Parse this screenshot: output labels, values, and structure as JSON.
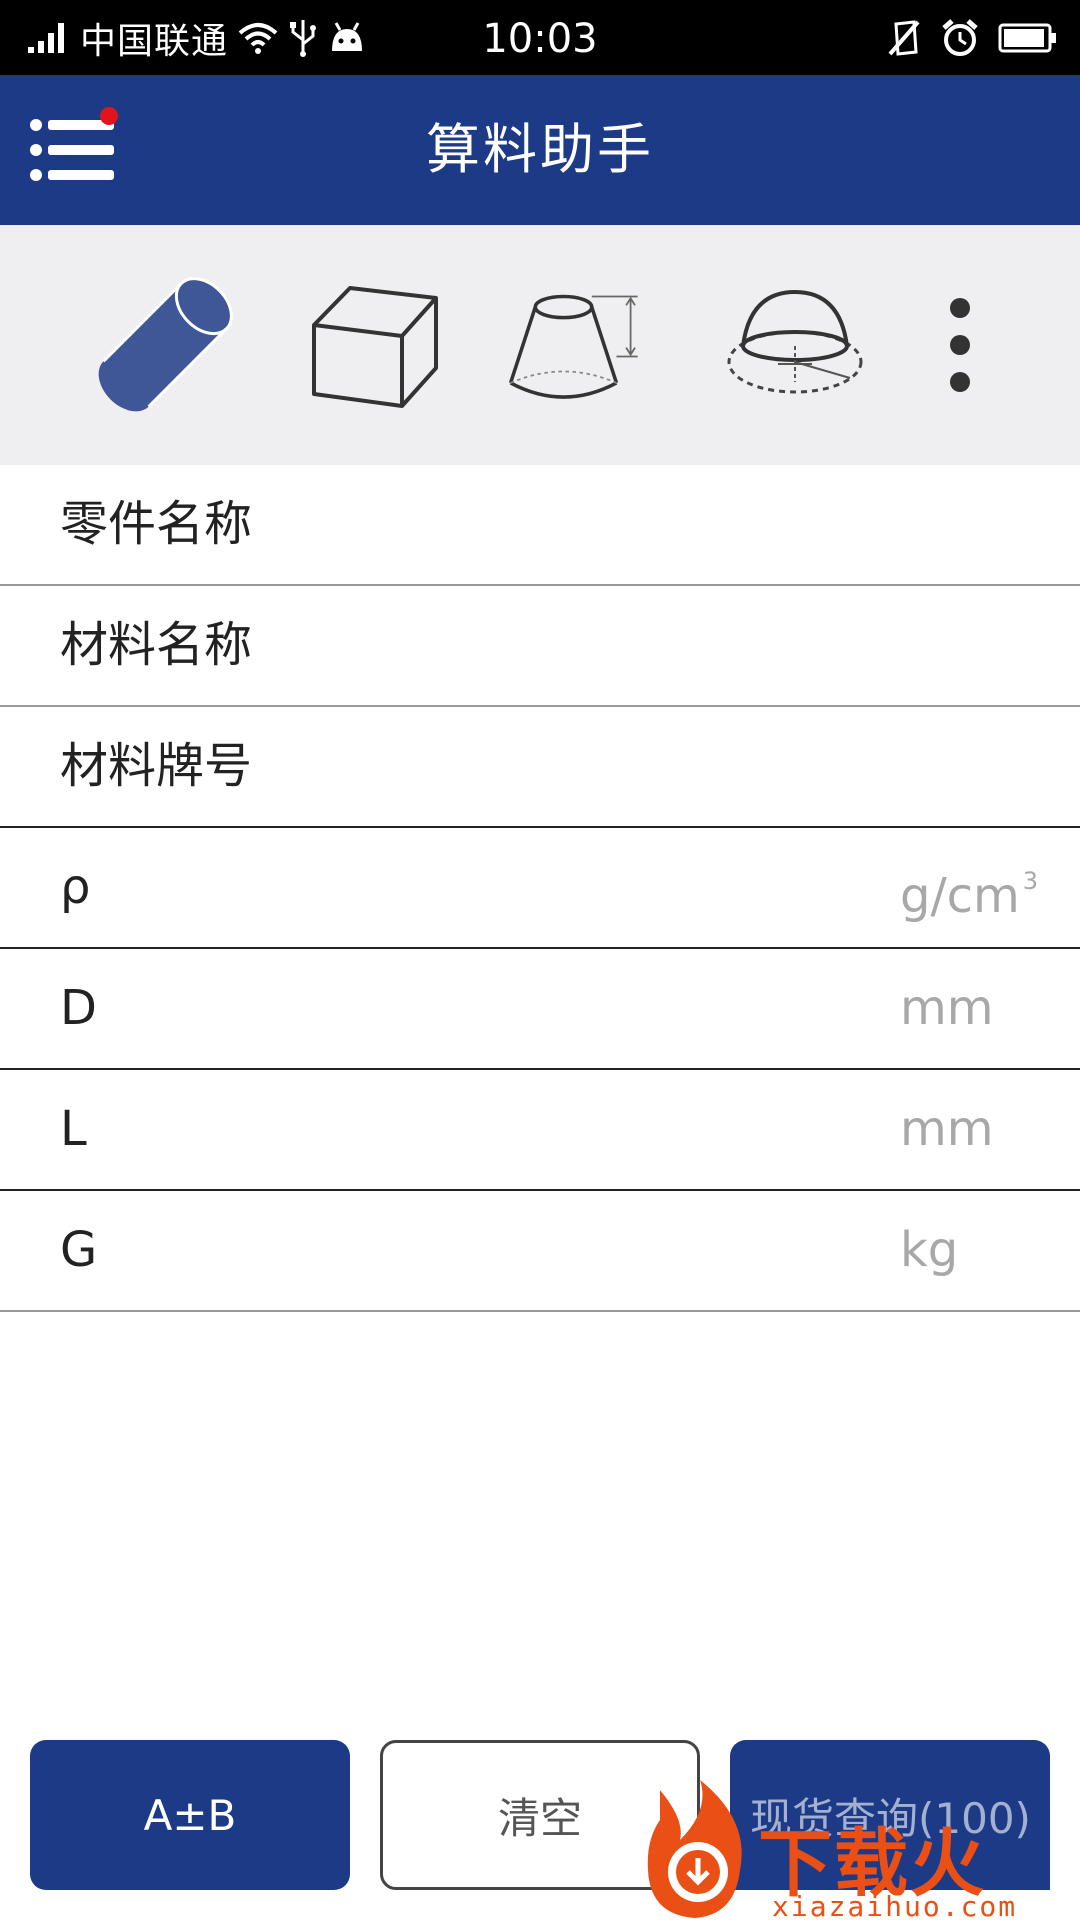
{
  "status_bar": {
    "carrier": "中国联通",
    "time": "10:03"
  },
  "header": {
    "title": "算料助手"
  },
  "shapes": [
    {
      "icon": "cylinder-icon",
      "selected": true
    },
    {
      "icon": "cuboid-icon",
      "selected": false
    },
    {
      "icon": "frustum-icon",
      "selected": false
    },
    {
      "icon": "spherical-cap-icon",
      "selected": false
    }
  ],
  "form": {
    "part_name_label": "零件名称",
    "material_name_label": "材料名称",
    "material_grade_label": "材料牌号",
    "density_label": "ρ",
    "density_unit": "g/cm",
    "density_unit_sup": "3",
    "diameter_label": "D",
    "diameter_unit": "mm",
    "length_label": "L",
    "length_unit": "mm",
    "weight_label": "G",
    "weight_unit": "kg"
  },
  "buttons": {
    "tolerance_label": "A±B",
    "clear_label": "清空",
    "stock_label": "现货查询(100)"
  },
  "watermark": {
    "text": "下载火",
    "url": "xiazaihuo.com"
  },
  "colors": {
    "brand": "#1d3a87",
    "notification_dot": "#e0141a",
    "watermark": "#ea4f16"
  }
}
